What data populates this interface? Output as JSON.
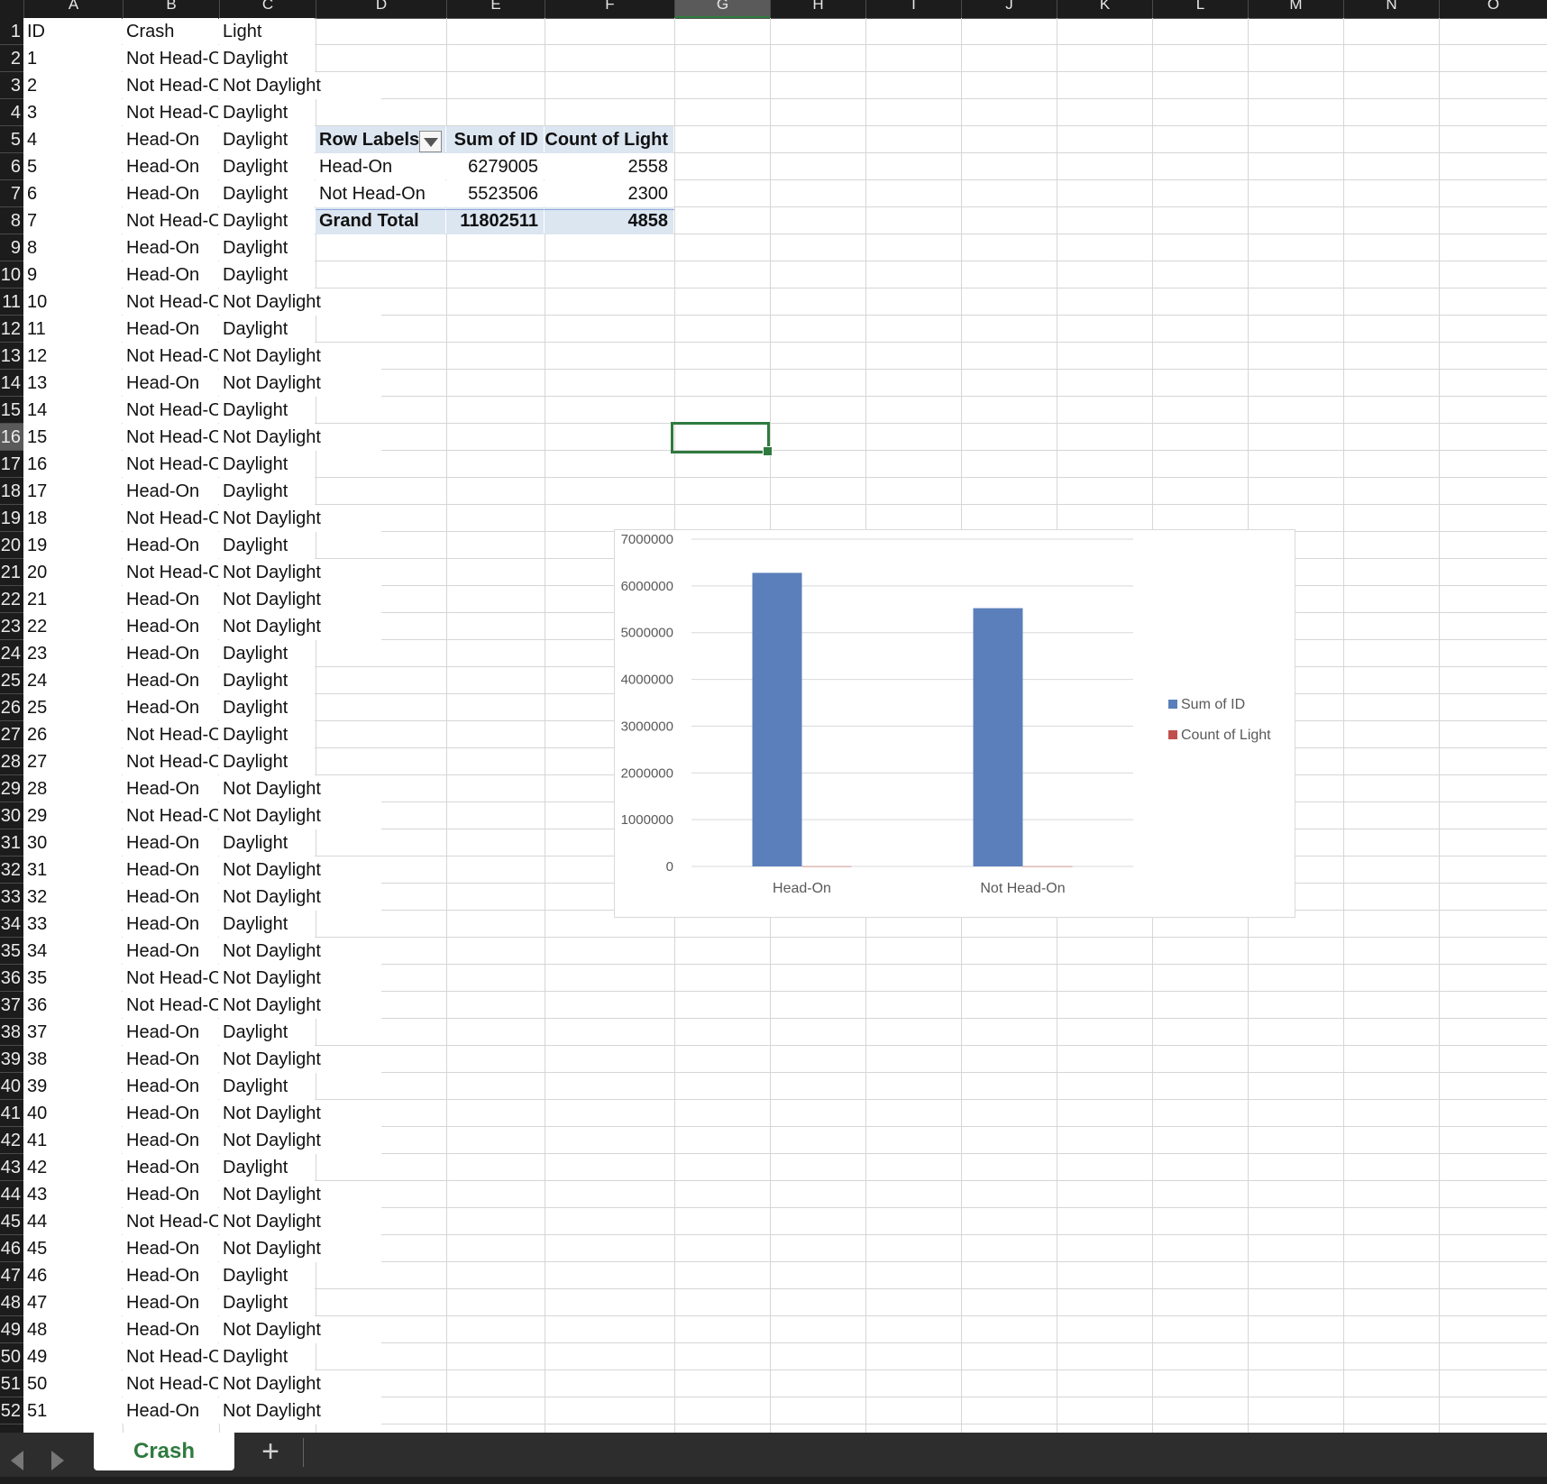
{
  "spreadsheet": {
    "column_headers": [
      "A",
      "B",
      "C",
      "D",
      "E",
      "F",
      "G",
      "H",
      "I",
      "J",
      "K",
      "L",
      "M",
      "N",
      "O"
    ],
    "selected_column": "G",
    "selected_row": 16,
    "row_headers": [
      "1",
      "2",
      "3",
      "4",
      "5",
      "6",
      "7",
      "8",
      "9",
      "10",
      "11",
      "12",
      "13",
      "14",
      "15",
      "16",
      "17",
      "18",
      "19",
      "20",
      "21",
      "22",
      "23",
      "24",
      "25",
      "26",
      "27",
      "28",
      "29",
      "30",
      "31",
      "32",
      "33",
      "34",
      "35",
      "36",
      "37",
      "38",
      "39",
      "40",
      "41",
      "42",
      "43",
      "44",
      "45",
      "46",
      "47",
      "48",
      "49",
      "50",
      "51",
      "52"
    ],
    "header_row": {
      "id": "ID",
      "crash": "Crash",
      "light": "Light"
    },
    "rows": [
      {
        "id": "1",
        "crash": "Not Head-On",
        "light": "Daylight"
      },
      {
        "id": "2",
        "crash": "Not Head-On",
        "light": "Not Daylight"
      },
      {
        "id": "3",
        "crash": "Not Head-On",
        "light": "Daylight"
      },
      {
        "id": "4",
        "crash": "Head-On",
        "light": "Daylight"
      },
      {
        "id": "5",
        "crash": "Head-On",
        "light": "Daylight"
      },
      {
        "id": "6",
        "crash": "Head-On",
        "light": "Daylight"
      },
      {
        "id": "7",
        "crash": "Not Head-On",
        "light": "Daylight"
      },
      {
        "id": "8",
        "crash": "Head-On",
        "light": "Daylight"
      },
      {
        "id": "9",
        "crash": "Head-On",
        "light": "Daylight"
      },
      {
        "id": "10",
        "crash": "Not Head-On",
        "light": "Not Daylight"
      },
      {
        "id": "11",
        "crash": "Head-On",
        "light": "Daylight"
      },
      {
        "id": "12",
        "crash": "Not Head-On",
        "light": "Not Daylight"
      },
      {
        "id": "13",
        "crash": "Head-On",
        "light": "Not Daylight"
      },
      {
        "id": "14",
        "crash": "Not Head-On",
        "light": "Daylight"
      },
      {
        "id": "15",
        "crash": "Not Head-On",
        "light": "Not Daylight"
      },
      {
        "id": "16",
        "crash": "Not Head-On",
        "light": "Daylight"
      },
      {
        "id": "17",
        "crash": "Head-On",
        "light": "Daylight"
      },
      {
        "id": "18",
        "crash": "Not Head-On",
        "light": "Not Daylight"
      },
      {
        "id": "19",
        "crash": "Head-On",
        "light": "Daylight"
      },
      {
        "id": "20",
        "crash": "Not Head-On",
        "light": "Not Daylight"
      },
      {
        "id": "21",
        "crash": "Head-On",
        "light": "Not Daylight"
      },
      {
        "id": "22",
        "crash": "Head-On",
        "light": "Not Daylight"
      },
      {
        "id": "23",
        "crash": "Head-On",
        "light": "Daylight"
      },
      {
        "id": "24",
        "crash": "Head-On",
        "light": "Daylight"
      },
      {
        "id": "25",
        "crash": "Head-On",
        "light": "Daylight"
      },
      {
        "id": "26",
        "crash": "Not Head-On",
        "light": "Daylight"
      },
      {
        "id": "27",
        "crash": "Not Head-On",
        "light": "Daylight"
      },
      {
        "id": "28",
        "crash": "Head-On",
        "light": "Not Daylight"
      },
      {
        "id": "29",
        "crash": "Not Head-On",
        "light": "Not Daylight"
      },
      {
        "id": "30",
        "crash": "Head-On",
        "light": "Daylight"
      },
      {
        "id": "31",
        "crash": "Head-On",
        "light": "Not Daylight"
      },
      {
        "id": "32",
        "crash": "Head-On",
        "light": "Not Daylight"
      },
      {
        "id": "33",
        "crash": "Head-On",
        "light": "Daylight"
      },
      {
        "id": "34",
        "crash": "Head-On",
        "light": "Not Daylight"
      },
      {
        "id": "35",
        "crash": "Not Head-On",
        "light": "Not Daylight"
      },
      {
        "id": "36",
        "crash": "Not Head-On",
        "light": "Not Daylight"
      },
      {
        "id": "37",
        "crash": "Head-On",
        "light": "Daylight"
      },
      {
        "id": "38",
        "crash": "Head-On",
        "light": "Not Daylight"
      },
      {
        "id": "39",
        "crash": "Head-On",
        "light": "Daylight"
      },
      {
        "id": "40",
        "crash": "Head-On",
        "light": "Not Daylight"
      },
      {
        "id": "41",
        "crash": "Head-On",
        "light": "Not Daylight"
      },
      {
        "id": "42",
        "crash": "Head-On",
        "light": "Daylight"
      },
      {
        "id": "43",
        "crash": "Head-On",
        "light": "Not Daylight"
      },
      {
        "id": "44",
        "crash": "Not Head-On",
        "light": "Not Daylight"
      },
      {
        "id": "45",
        "crash": "Head-On",
        "light": "Not Daylight"
      },
      {
        "id": "46",
        "crash": "Head-On",
        "light": "Daylight"
      },
      {
        "id": "47",
        "crash": "Head-On",
        "light": "Daylight"
      },
      {
        "id": "48",
        "crash": "Head-On",
        "light": "Not Daylight"
      },
      {
        "id": "49",
        "crash": "Not Head-On",
        "light": "Daylight"
      },
      {
        "id": "50",
        "crash": "Not Head-On",
        "light": "Not Daylight"
      },
      {
        "id": "51",
        "crash": "Head-On",
        "light": "Not Daylight"
      }
    ]
  },
  "pivot": {
    "headers": [
      "Row Labels",
      "Sum of ID",
      "Count of Light"
    ],
    "rows": [
      {
        "label": "Head-On",
        "sum": "6279005",
        "count": "2558"
      },
      {
        "label": "Not Head-On",
        "sum": "5523506",
        "count": "2300"
      }
    ],
    "total": {
      "label": "Grand Total",
      "sum": "11802511",
      "count": "4858"
    }
  },
  "chart_data": {
    "type": "bar",
    "categories": [
      "Head-On",
      "Not Head-On"
    ],
    "series": [
      {
        "name": "Sum of ID",
        "values": [
          6279005,
          5523506
        ],
        "color": "#5b7fba"
      },
      {
        "name": "Count of Light",
        "values": [
          2558,
          2300
        ],
        "color": "#c0504d"
      }
    ],
    "y_ticks": [
      "0",
      "1000000",
      "2000000",
      "3000000",
      "4000000",
      "5000000",
      "6000000",
      "7000000"
    ],
    "ylim": [
      0,
      7000000
    ],
    "grid": true,
    "legend": "right"
  },
  "sheet_tabs": {
    "active": "Crash",
    "add_label": "+"
  },
  "icons": {
    "filter": "filter-dropdown-icon",
    "prev": "chevron-left-icon",
    "next": "chevron-right-icon",
    "add": "plus-icon"
  },
  "colors": {
    "accent": "#2f7a3f",
    "pivot_band": "#dce6f1",
    "header_bg": "#1c1c1c"
  }
}
